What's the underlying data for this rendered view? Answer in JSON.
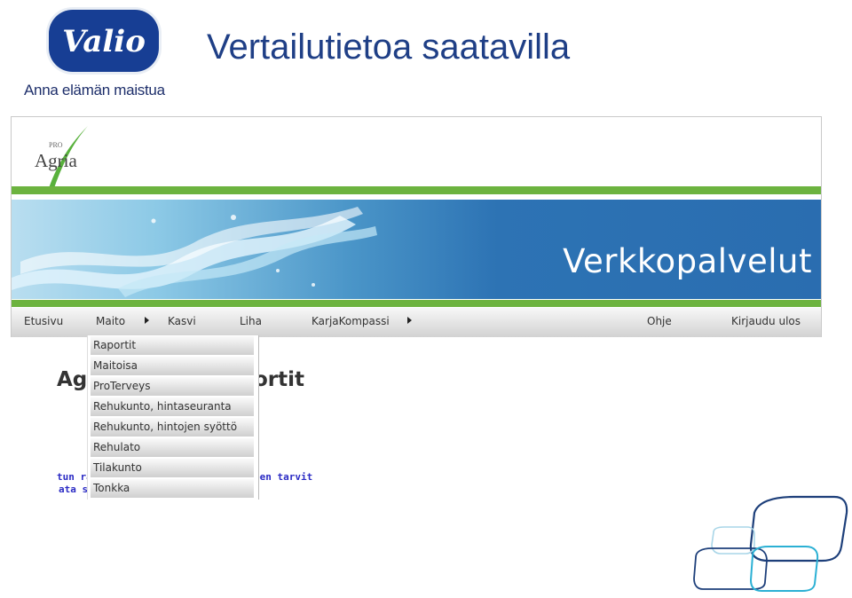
{
  "slide": {
    "logo_text": "Valio",
    "tagline": "Anna elämän maistua",
    "title": "Vertailutietoa saatavilla"
  },
  "site": {
    "logo_small": "PRO",
    "logo_text": "Agria",
    "banner_title": "Verkkopalvelut",
    "nav": {
      "etusivu": "Etusivu",
      "maito": "Maito",
      "kasvi": "Kasvi",
      "liha": "Liha",
      "karjakompassi": "KarjaKompassi",
      "ohje": "Ohje",
      "logout": "Kirjaudu ulos"
    }
  },
  "dropdown": {
    "items": [
      "Raportit",
      "Maitoisa",
      "ProTerveys",
      "Rehukunto, hintaseuranta",
      "Rehukunto, hintojen syöttö",
      "Rehulato",
      "Tilakunto",
      "Tonkka"
    ]
  },
  "page": {
    "heading_left": "Ag",
    "heading_right": "ortit",
    "text_left_1": "tun ra",
    "text_left_2": "ata s",
    "text_right_1": "een tarvit"
  },
  "colors": {
    "brand_blue": "#1f3f86",
    "green": "#6cb33f",
    "link_blue": "#2a2ac4"
  }
}
